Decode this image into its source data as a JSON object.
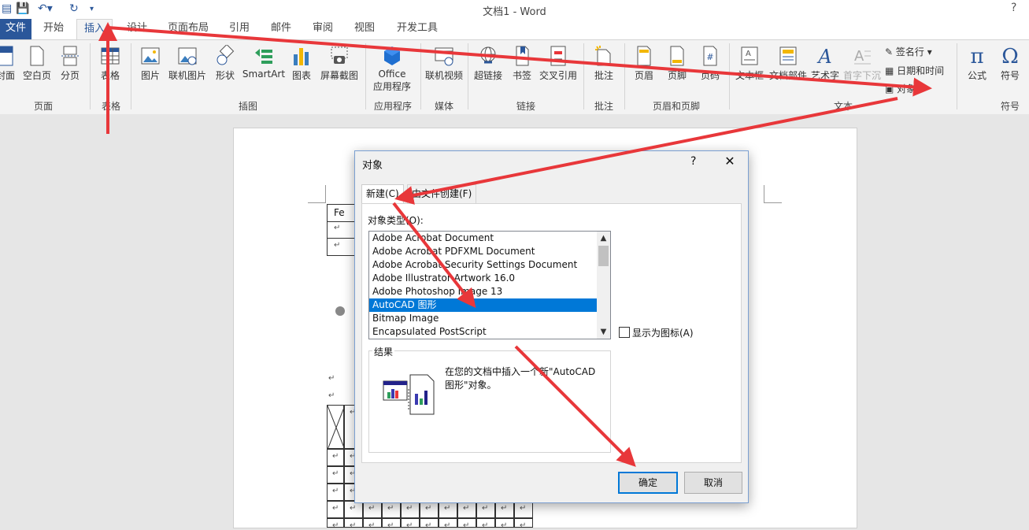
{
  "window": {
    "title": "文档1 - Word"
  },
  "tabs": [
    "文件",
    "开始",
    "插入",
    "设计",
    "页面布局",
    "引用",
    "邮件",
    "审阅",
    "视图",
    "开发工具"
  ],
  "ribbon": {
    "pages": {
      "cover_label": "封面",
      "blank_label": "空白页",
      "break_label": "分页",
      "group": "页面"
    },
    "tables": {
      "table_label": "表格",
      "group": "表格"
    },
    "illustrations": {
      "pictures": "图片",
      "online_pictures": "联机图片",
      "shapes": "形状",
      "smartart": "SmartArt",
      "chart": "图表",
      "screenshot": "屏幕截图",
      "group": "插图"
    },
    "apps": {
      "office_line1": "Office",
      "office_line2": "应用程序",
      "group": "应用程序"
    },
    "media": {
      "online_video": "联机视频",
      "group": "媒体"
    },
    "links": {
      "hyperlink": "超链接",
      "bookmark": "书签",
      "crossref": "交叉引用",
      "group": "链接"
    },
    "comments": {
      "comment": "批注",
      "group": "批注"
    },
    "headerfooter": {
      "header": "页眉",
      "footer": "页脚",
      "pagenum": "页码",
      "group": "页眉和页脚"
    },
    "text": {
      "textbox": "文本框",
      "quickparts": "文档部件",
      "wordart": "艺术字",
      "dropcap": "首字下沉",
      "signature": "签名行",
      "datetime": "日期和时间",
      "object": "对象",
      "group": "文本"
    },
    "symbols": {
      "equation": "公式",
      "symbol": "符号",
      "group": "符号"
    }
  },
  "document": {
    "cell_text": "Fe",
    "return_mark": "↵"
  },
  "dialog": {
    "title": "对象",
    "help": "?",
    "tabs": {
      "new": "新建(C)",
      "from_file": "由文件创建(F)"
    },
    "objtype_label": "对象类型(O):",
    "objtypes": [
      "Adobe Acrobat Document",
      "Adobe Acrobat PDFXML Document",
      "Adobe Acrobat Security Settings Document",
      "Adobe Illustrator Artwork 16.0",
      "Adobe Photoshop Image 13",
      "AutoCAD 图形",
      "Bitmap Image",
      "Encapsulated PostScript"
    ],
    "selected_index": 5,
    "display_as_icon": "显示为图标(A)",
    "result_title": "结果",
    "result_text": "在您的文档中插入一个新\"AutoCAD 图形\"对象。",
    "ok": "确定",
    "cancel": "取消"
  },
  "colors": {
    "accent": "#2b579a",
    "selection": "#0078d7",
    "arrow": "#e8373a"
  }
}
